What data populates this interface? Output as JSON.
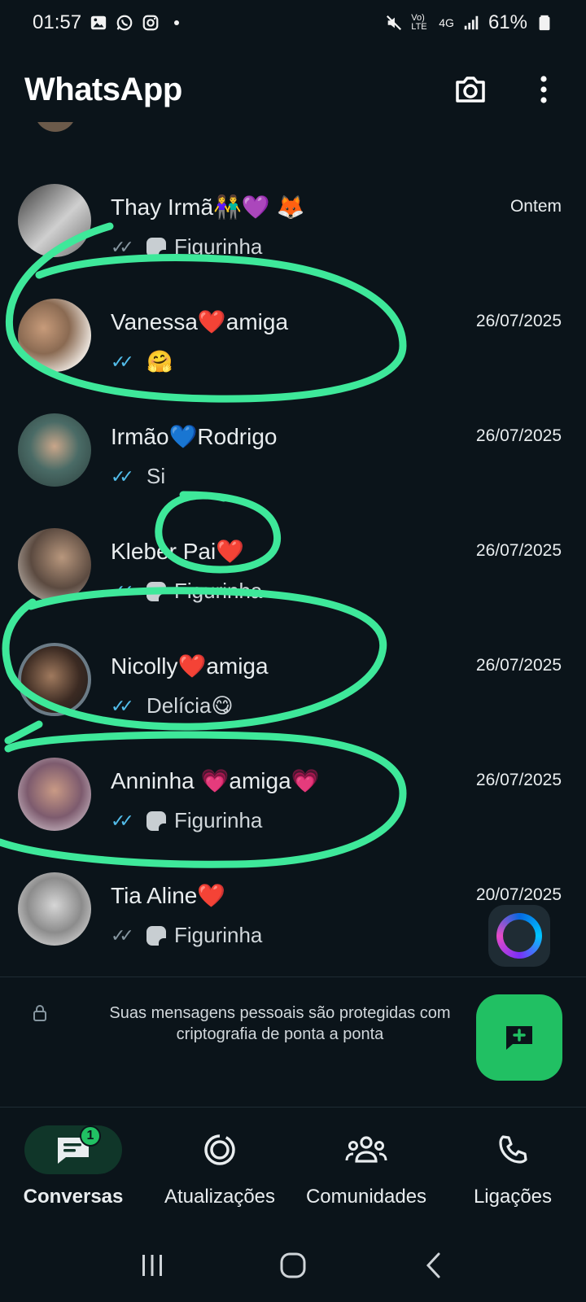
{
  "status_bar": {
    "time": "01:57",
    "battery": "61%",
    "network": "4G",
    "volte": "Vo) LTE"
  },
  "header": {
    "title": "WhatsApp"
  },
  "chats": [
    {
      "name": "Thay Irmã👫💜 🦊",
      "time": "Ontem",
      "ticks": "sent",
      "sticker": true,
      "preview": "Figurinha"
    },
    {
      "name": "Vanessa❤️amiga",
      "time": "26/07/2025",
      "ticks": "read",
      "sticker": false,
      "preview": "🤗"
    },
    {
      "name": "Irmão💙Rodrigo",
      "time": "26/07/2025",
      "ticks": "read",
      "sticker": false,
      "preview": "Si"
    },
    {
      "name": "Kleber Pai❤️",
      "time": "26/07/2025",
      "ticks": "read",
      "sticker": true,
      "preview": "Figurinha"
    },
    {
      "name": "Nicolly❤️amiga",
      "time": "26/07/2025",
      "ticks": "read",
      "sticker": false,
      "preview": "Delícia😋"
    },
    {
      "name": "Anninha 💗amiga💗",
      "time": "26/07/2025",
      "ticks": "read",
      "sticker": true,
      "preview": "Figurinha"
    },
    {
      "name": "Tia Aline❤️",
      "time": "20/07/2025",
      "ticks": "sent",
      "sticker": true,
      "preview": "Figurinha"
    }
  ],
  "encryption_note": "Suas mensagens pessoais são protegidas com criptografia de ponta a ponta",
  "nav": {
    "conversas": "Conversas",
    "conversas_badge": "1",
    "atualizacoes": "Atualizações",
    "comunidades": "Comunidades",
    "ligacoes": "Ligações"
  },
  "colors": {
    "background": "#0b141a",
    "accent": "#21c063",
    "read_ticks": "#53bdeb",
    "annotation": "#3ee89a"
  }
}
